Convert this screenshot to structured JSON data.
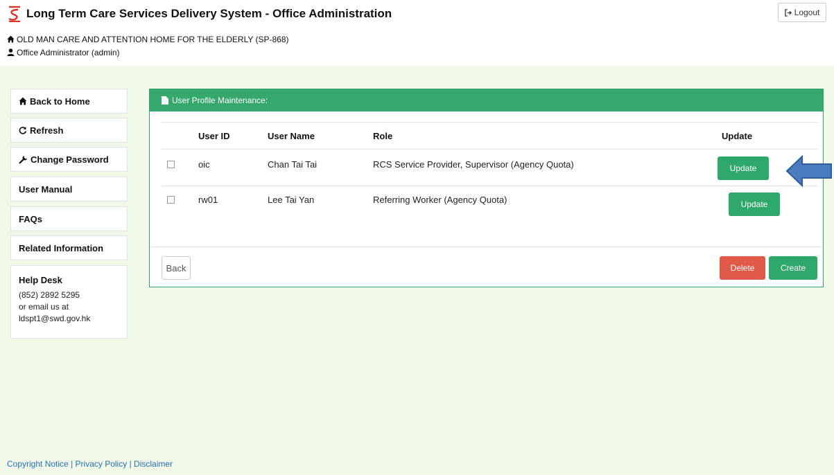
{
  "app": {
    "title": "Long Term Care Services Delivery System - Office Administration",
    "organization": "OLD MAN CARE AND ATTENTION HOME FOR THE ELDERLY (SP-868)",
    "user": "Office Administrator (admin)",
    "logout_label": "Logout"
  },
  "sidebar": {
    "items": [
      {
        "label": "Back to Home",
        "icon": "home-icon"
      },
      {
        "label": "Refresh",
        "icon": "refresh-icon"
      },
      {
        "label": "Change Password",
        "icon": "wrench-icon"
      },
      {
        "label": "User Manual"
      },
      {
        "label": "FAQs"
      },
      {
        "label": "Related Information"
      }
    ],
    "helpdesk": {
      "title": "Help Desk",
      "phone": "(852) 2892 5295",
      "email_prefix": "or email us at",
      "email": "ldspt1@swd.gov.hk"
    }
  },
  "panel": {
    "title": "User Profile Maintenance:",
    "columns": [
      "User ID",
      "User Name",
      "Role",
      "Update"
    ],
    "rows": [
      {
        "user_id": "oic",
        "user_name": "Chan Tai Tai",
        "role": "RCS Service Provider, Supervisor (Agency Quota)",
        "update_label": "Update"
      },
      {
        "user_id": "rw01",
        "user_name": "Lee Tai Yan",
        "role": "Referring Worker (Agency Quota)",
        "update_label": "Update"
      }
    ],
    "back_label": "Back",
    "delete_label": "Delete",
    "create_label": "Create"
  },
  "footer": {
    "links": [
      "Copyright Notice",
      "Privacy Policy",
      "Disclaimer"
    ]
  },
  "colors": {
    "brand_green": "#36a86e",
    "button_green": "#2fa86c",
    "delete_red": "#e05a4a",
    "content_bg": "#f1f9e8",
    "link_blue": "#2a6fb0",
    "logo_red": "#d9342b",
    "arrow_blue": "#4a7bbf"
  }
}
